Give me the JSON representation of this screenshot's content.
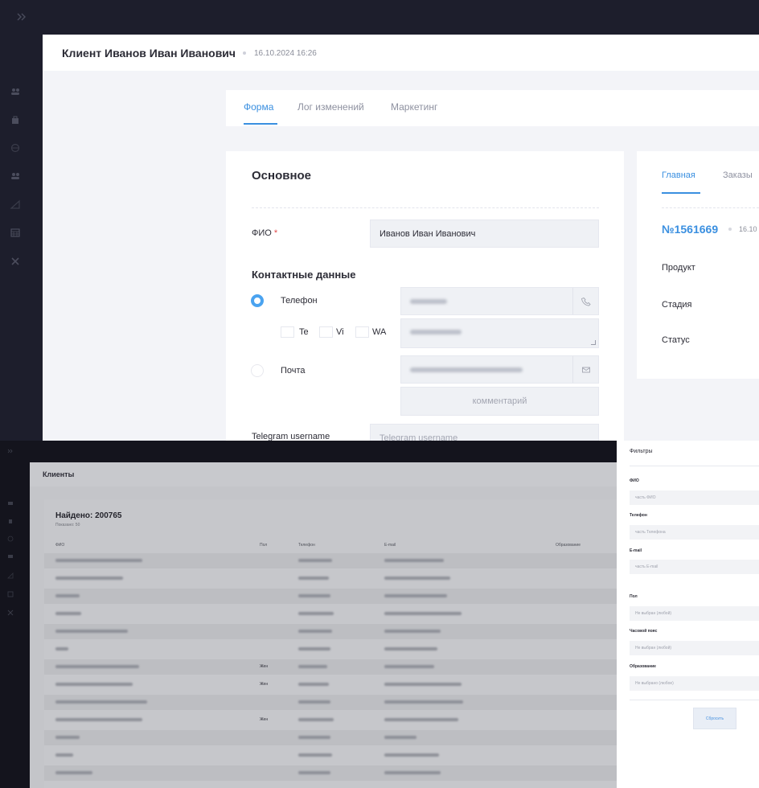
{
  "top": {
    "header": {
      "title": "Клиент Иванов Иван Иванович",
      "date": "16.10.2024 16:26"
    },
    "tabs": [
      {
        "label": "Форма",
        "active": true
      },
      {
        "label": "Лог изменений",
        "active": false
      },
      {
        "label": "Маркетинг",
        "active": false
      }
    ],
    "form": {
      "section_title": "Основное",
      "fio": {
        "label": "ФИО",
        "required_mark": "*",
        "value": "Иванов Иван Иванович"
      },
      "contacts_title": "Контактные данные",
      "phone_label": "Телефон",
      "messengers": [
        "Te",
        "Vi",
        "WA"
      ],
      "email_label": "Почта",
      "comment_placeholder": "комментарий",
      "telegram": {
        "label": "Telegram username",
        "placeholder": "Telegram username"
      }
    },
    "right_panel": {
      "tabs": [
        {
          "label": "Главная",
          "active": true
        },
        {
          "label": "Заказы",
          "active": false
        }
      ],
      "order_number": "№1561669",
      "order_date": "16.10",
      "fields": [
        "Продукт",
        "Стадия",
        "Статус"
      ]
    }
  },
  "bottom": {
    "title": "Клиенты",
    "found": "Найдено: 200765",
    "shown": "Показано: 50",
    "columns": [
      "ФИО",
      "Пол",
      "Телефон",
      "E-mail",
      "Образование"
    ],
    "gender_values": [
      "Жен",
      "Жен",
      "Жен"
    ],
    "filters": {
      "title": "Фильтры",
      "fio": {
        "label": "ФИО",
        "placeholder": "часть ФИО"
      },
      "phone": {
        "label": "Телефон",
        "placeholder": "часть Телефона"
      },
      "email": {
        "label": "E-mail",
        "placeholder": "часть E-mail"
      },
      "gender": {
        "label": "Пол",
        "value": "Не выбран (любой)"
      },
      "timezone": {
        "label": "Часовой пояс",
        "value": "Не выбран (любой)"
      },
      "education": {
        "label": "Образование",
        "value": "Не выбрано (любое)"
      },
      "reset_label": "Сбросить"
    }
  },
  "colors": {
    "accent": "#3a8fe0",
    "sidebar": "#1d1e2c",
    "required": "#e04a4a"
  }
}
